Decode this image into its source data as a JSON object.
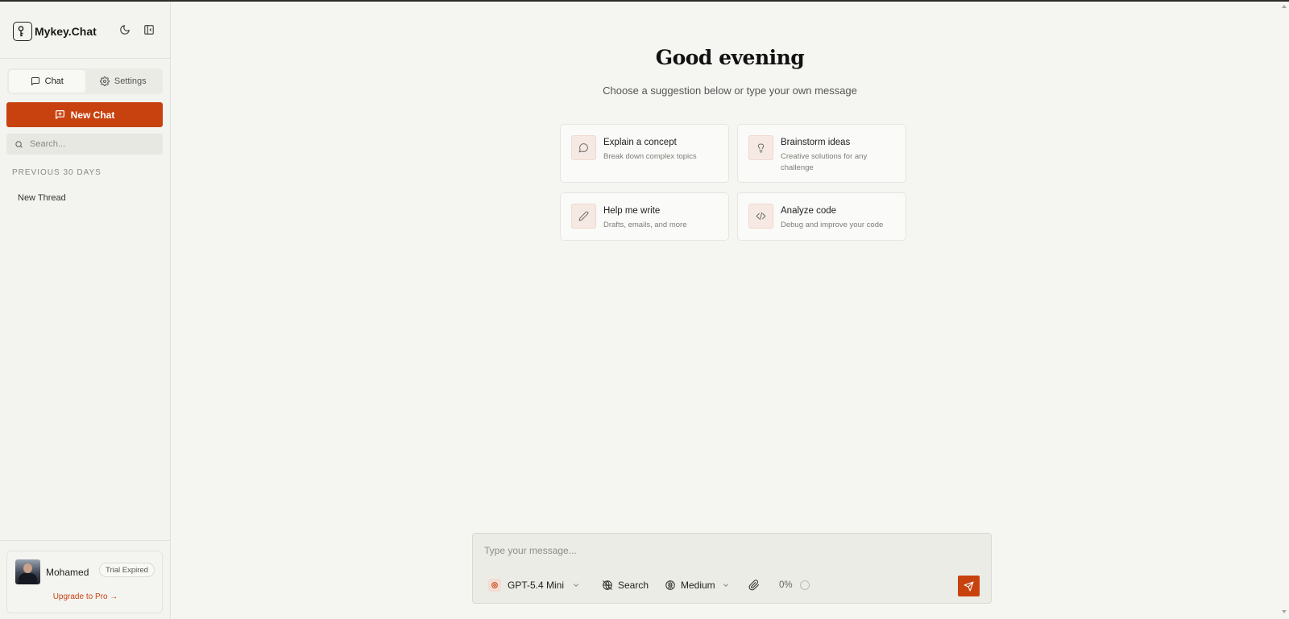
{
  "app": {
    "name": "Mykey.Chat",
    "accent_color": "#c8420f"
  },
  "sidebar": {
    "tabs": [
      {
        "label": "Chat",
        "icon": "message-square-icon",
        "active": true
      },
      {
        "label": "Settings",
        "icon": "gear-icon",
        "active": false
      }
    ],
    "new_chat_label": "New Chat",
    "search_placeholder": "Search...",
    "section_label": "PREVIOUS 30 DAYS",
    "threads": [
      {
        "title": "New Thread"
      }
    ],
    "user": {
      "name": "Mohamed",
      "badge": "Trial Expired",
      "upgrade_label": "Upgrade to Pro →"
    }
  },
  "main": {
    "greeting": "Good evening",
    "subtitle": "Choose a suggestion below or type your own message",
    "suggestions": [
      {
        "title": "Explain a concept",
        "description": "Break down complex topics",
        "icon": "message-circle-icon"
      },
      {
        "title": "Brainstorm ideas",
        "description": "Creative solutions for any challenge",
        "icon": "lightbulb-icon"
      },
      {
        "title": "Help me write",
        "description": "Drafts, emails, and more",
        "icon": "pencil-icon"
      },
      {
        "title": "Analyze code",
        "description": "Debug and improve your code",
        "icon": "code-icon"
      }
    ]
  },
  "composer": {
    "placeholder": "Type your message...",
    "model": "GPT-5.4 Mini",
    "search_label": "Search",
    "effort": "Medium",
    "usage": "0%"
  }
}
